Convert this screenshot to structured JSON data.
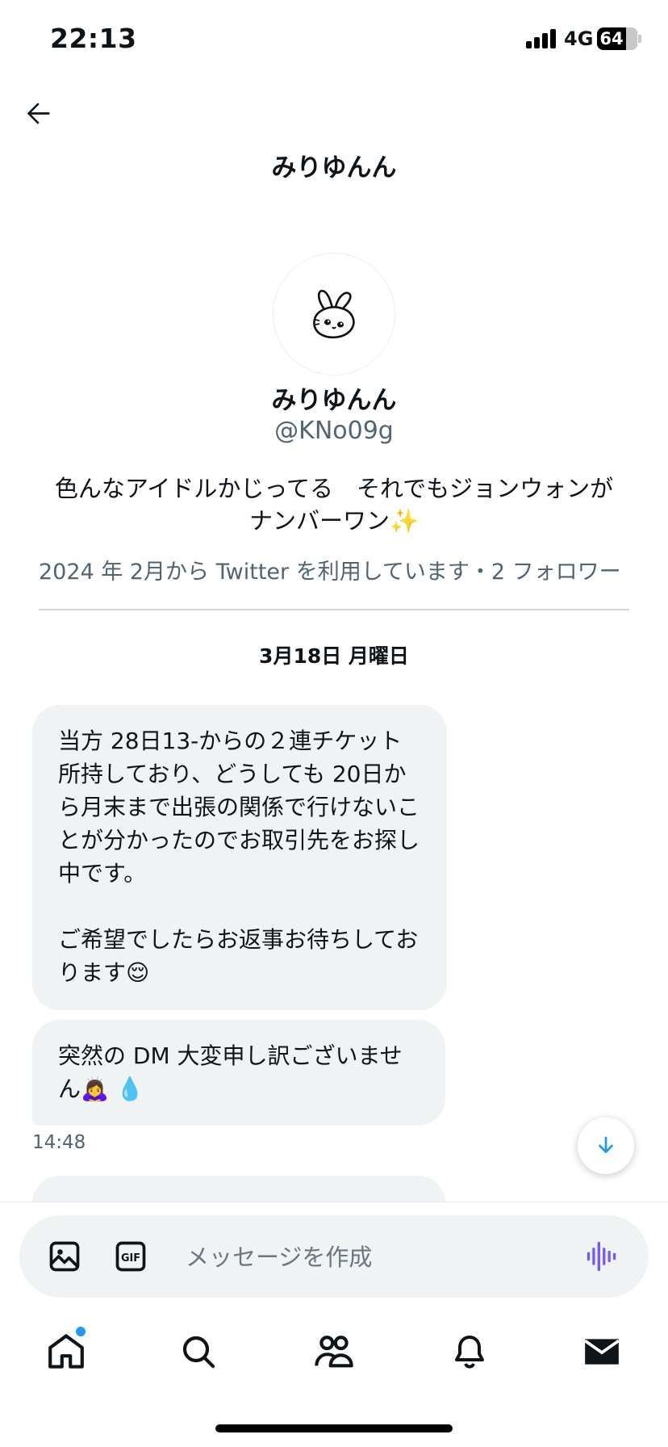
{
  "status_bar": {
    "time": "22:13",
    "network": "4G",
    "battery": "64"
  },
  "header": {
    "title": "みりゆんん"
  },
  "profile": {
    "name": "みりゆんん",
    "handle": "@KNo09g",
    "bio_line1": "色んなアイドルかじってる　それでもジョンウォンが",
    "bio_line2": "ナンバーワン✨",
    "meta": "2024 年 2月から Twitter を利用しています・2 フォロワー"
  },
  "conversation": {
    "date_label": "3月18日 月曜日",
    "messages": [
      {
        "text": "当方 28日13-からの２連チケット所持しており、どうしても 20日から月末まで出張の関係で行けないことが分かったのでお取引先をお探し中です。\n\nご希望でしたらお返事お待ちしております😌"
      },
      {
        "text": "突然の DM 大変申し訳ございません🙇‍♀️ 💧"
      }
    ],
    "timestamp": "14:48"
  },
  "composer": {
    "placeholder": "メッセージを作成"
  },
  "icons": {
    "back": "arrow-left-icon",
    "media": "image-icon",
    "gif": "gif-icon",
    "voice": "voice-wave-icon",
    "scroll_down": "arrow-down-icon",
    "home": "home-icon",
    "search": "search-icon",
    "communities": "people-icon",
    "notifications": "bell-icon",
    "messages": "mail-icon"
  },
  "colors": {
    "accent": "#1d9bf0",
    "voice": "#7856ff",
    "bubble": "#eff3f4",
    "secondary_text": "#536471"
  }
}
